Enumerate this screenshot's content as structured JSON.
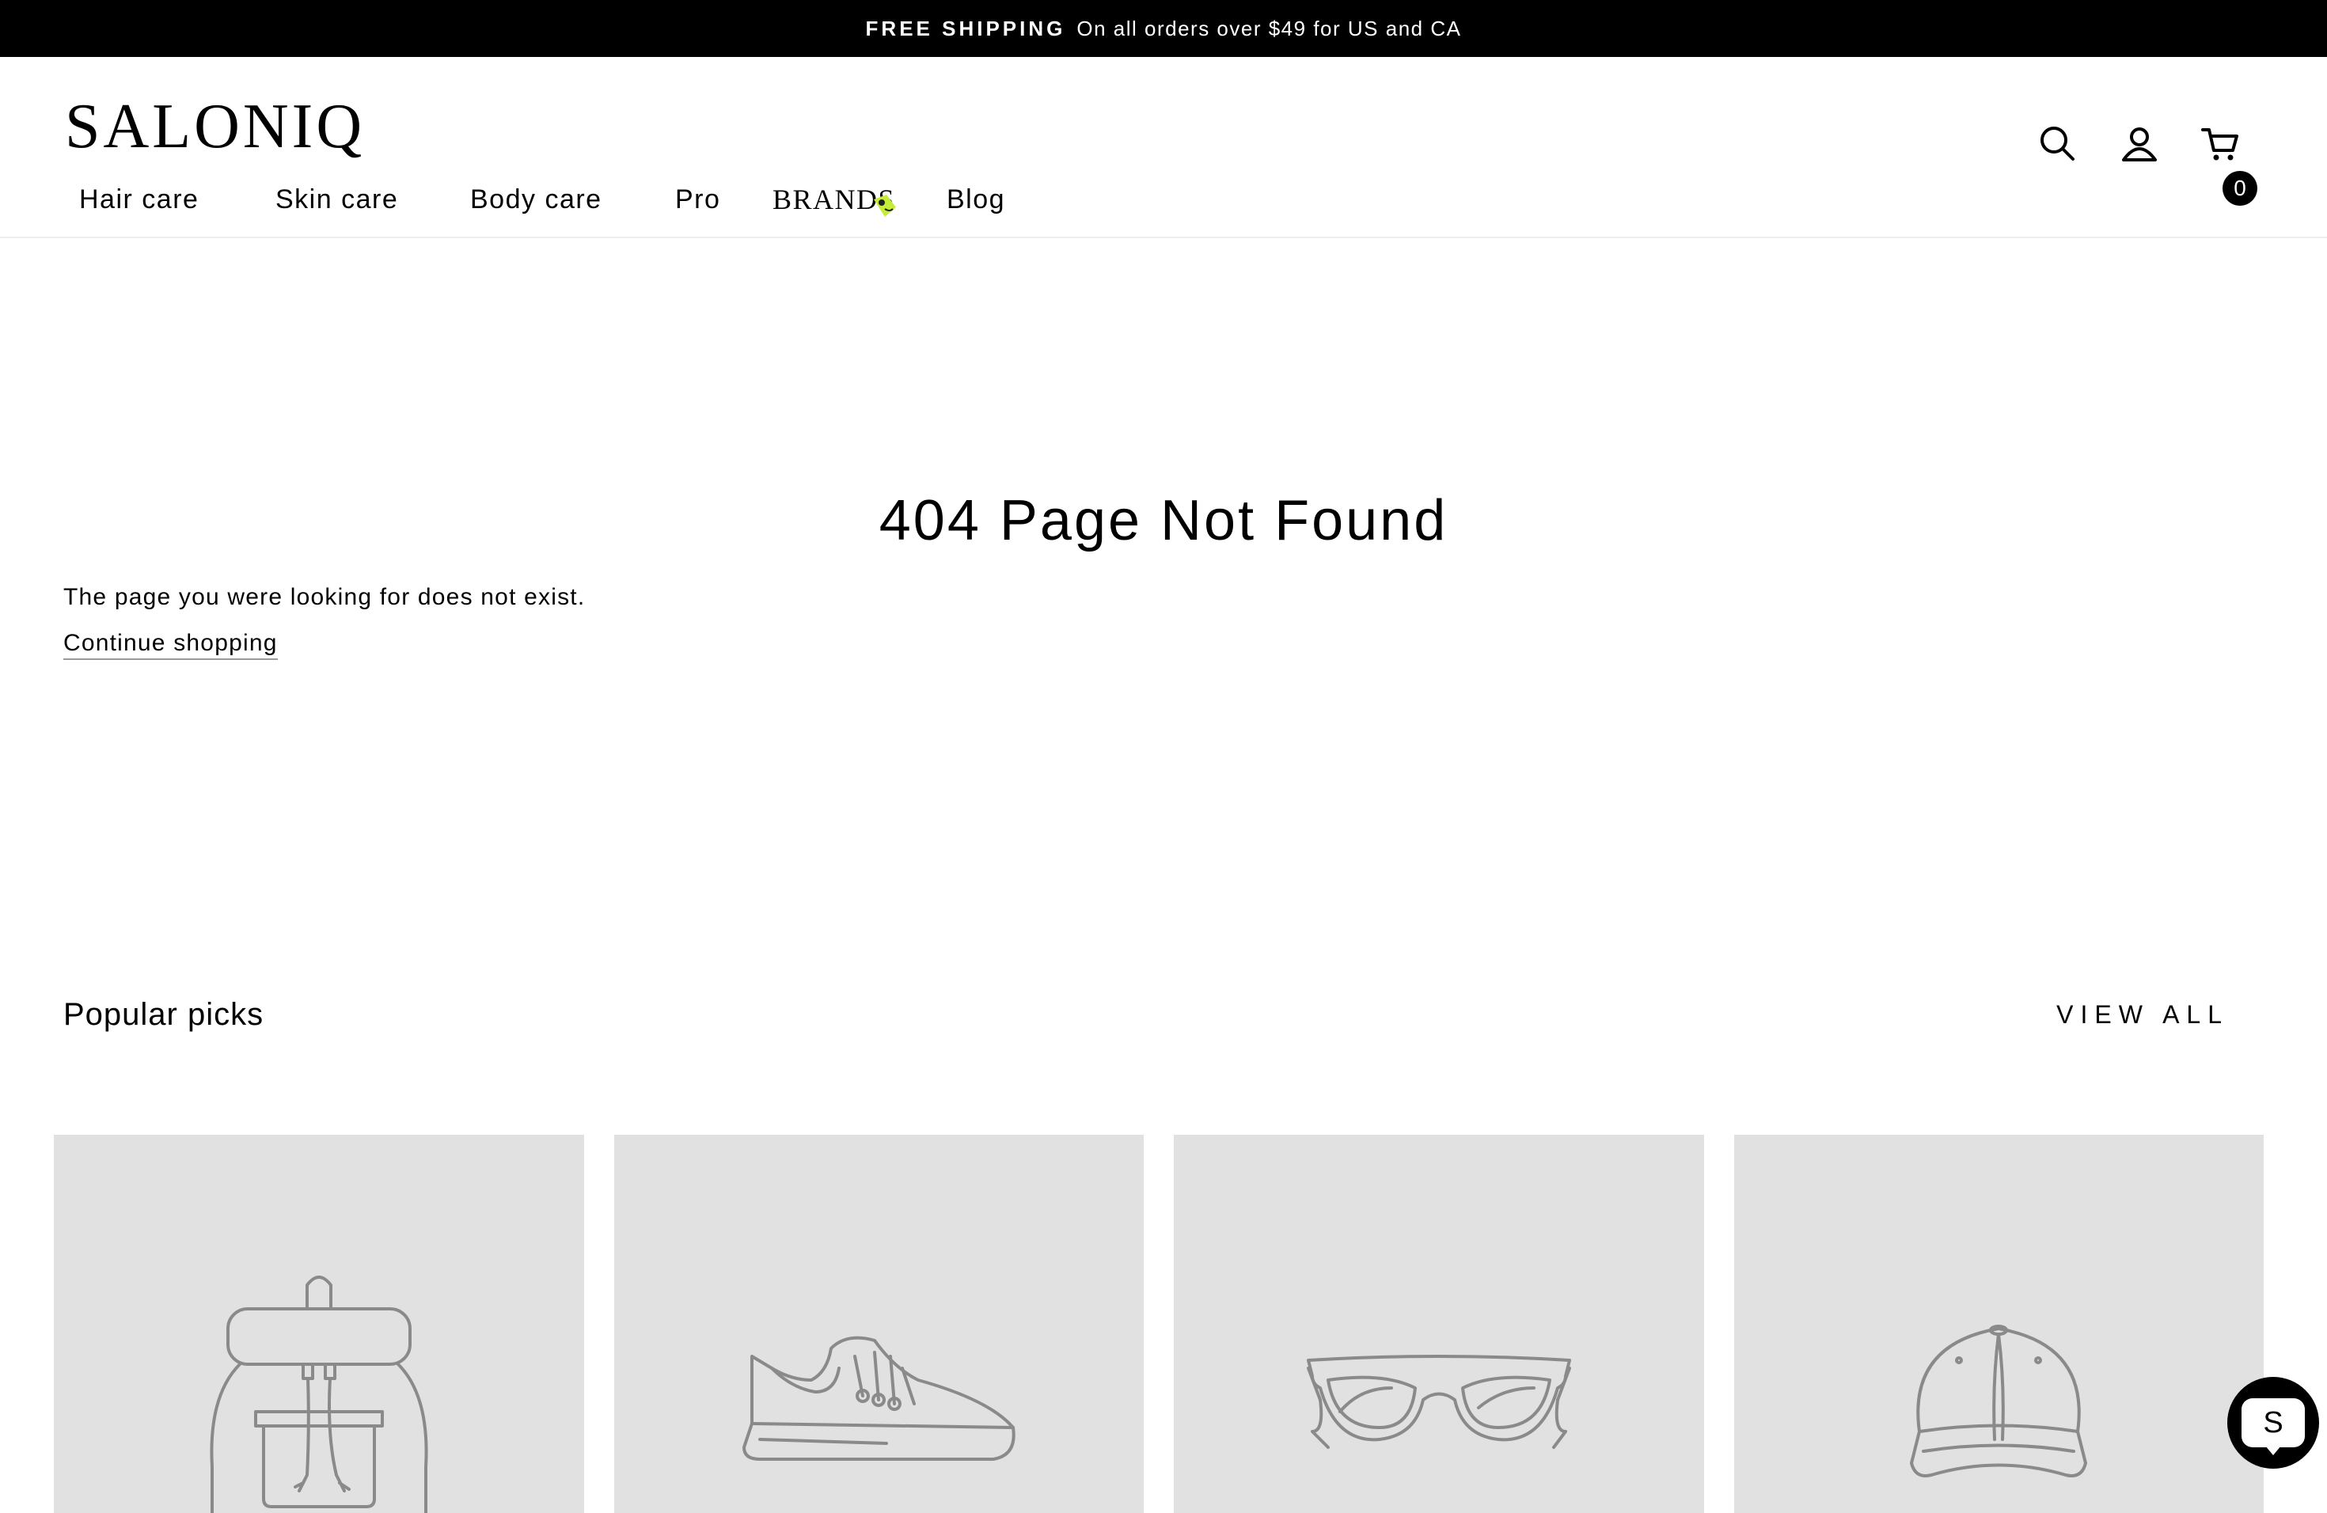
{
  "announcement": {
    "strong": "FREE SHIPPING",
    "text": "On all orders over $49 for US and CA"
  },
  "header": {
    "logo": "SALONIQ",
    "nav": [
      "Hair care",
      "Skin care",
      "Body care",
      "Pro",
      "BRANDS",
      "Blog"
    ],
    "icons": [
      "search-icon",
      "account-icon",
      "cart-icon"
    ],
    "cart_count": "0"
  },
  "main": {
    "title": "404 Page Not Found",
    "message": "The page you were looking for does not exist.",
    "continue_link": "Continue shopping"
  },
  "popular": {
    "title": "Popular picks",
    "view_all": "VIEW ALL",
    "products": [
      "backpack-icon",
      "sneaker-icon",
      "sunglasses-icon",
      "cap-icon"
    ]
  },
  "chat": {
    "label": "S"
  },
  "colors": {
    "announcement_bg": "#000000",
    "card_bg": "#e1e1e1",
    "illustration_stroke": "#8a8a8a"
  }
}
